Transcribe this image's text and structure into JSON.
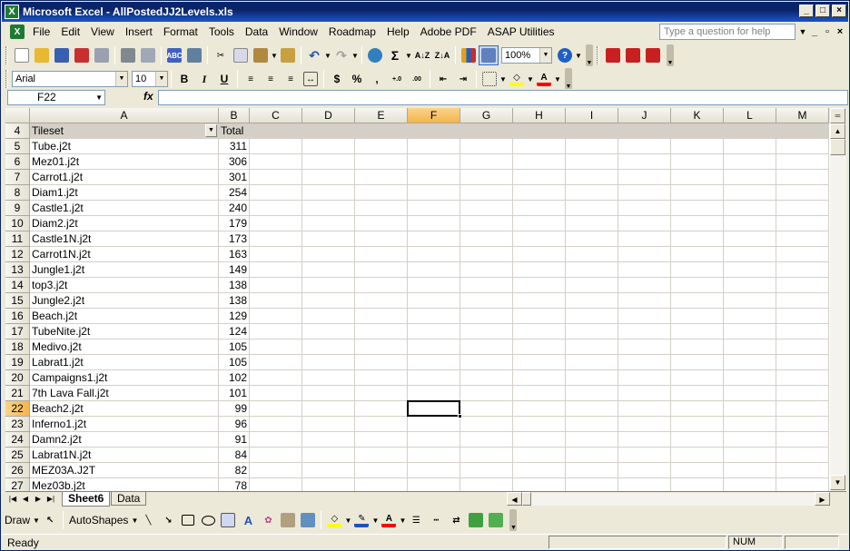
{
  "window": {
    "title": "Microsoft Excel - AllPostedJJ2Levels.xls"
  },
  "menu": {
    "items": [
      "File",
      "Edit",
      "View",
      "Insert",
      "Format",
      "Tools",
      "Data",
      "Window",
      "Roadmap",
      "Help",
      "Adobe PDF",
      "ASAP Utilities"
    ],
    "question_placeholder": "Type a question for help"
  },
  "toolbar": {
    "zoom": "100%"
  },
  "format_toolbar": {
    "font": "Arial",
    "size": "10",
    "bold": "B",
    "italic": "I",
    "underline": "U",
    "currency": "$",
    "percent": "%",
    "comma": ","
  },
  "formula_bar": {
    "name_box": "F22",
    "fx": "fx",
    "value": ""
  },
  "grid": {
    "columns": [
      "A",
      "B",
      "C",
      "D",
      "E",
      "F",
      "G",
      "H",
      "I",
      "J",
      "K",
      "L",
      "M"
    ],
    "selected_column": "F",
    "selected_row": "22",
    "header_row": {
      "row": "4",
      "a": "Tileset",
      "b": "Total"
    },
    "rows": [
      {
        "row": "5",
        "a": "Tube.j2t",
        "b": "311"
      },
      {
        "row": "6",
        "a": "Mez01.j2t",
        "b": "306"
      },
      {
        "row": "7",
        "a": "Carrot1.j2t",
        "b": "301"
      },
      {
        "row": "8",
        "a": "Diam1.j2t",
        "b": "254"
      },
      {
        "row": "9",
        "a": "Castle1.j2t",
        "b": "240"
      },
      {
        "row": "10",
        "a": "Diam2.j2t",
        "b": "179"
      },
      {
        "row": "11",
        "a": "Castle1N.j2t",
        "b": "173"
      },
      {
        "row": "12",
        "a": "Carrot1N.j2t",
        "b": "163"
      },
      {
        "row": "13",
        "a": "Jungle1.j2t",
        "b": "149"
      },
      {
        "row": "14",
        "a": "top3.j2t",
        "b": "138"
      },
      {
        "row": "15",
        "a": "Jungle2.j2t",
        "b": "138"
      },
      {
        "row": "16",
        "a": "Beach.j2t",
        "b": "129"
      },
      {
        "row": "17",
        "a": "TubeNite.j2t",
        "b": "124"
      },
      {
        "row": "18",
        "a": "Medivo.j2t",
        "b": "105"
      },
      {
        "row": "19",
        "a": "Labrat1.j2t",
        "b": "105"
      },
      {
        "row": "20",
        "a": "Campaigns1.j2t",
        "b": "102"
      },
      {
        "row": "21",
        "a": "7th Lava Fall.j2t",
        "b": "101"
      },
      {
        "row": "22",
        "a": "Beach2.j2t",
        "b": "99"
      },
      {
        "row": "23",
        "a": "Inferno1.j2t",
        "b": "96"
      },
      {
        "row": "24",
        "a": "Damn2.j2t",
        "b": "91"
      },
      {
        "row": "25",
        "a": "Labrat1N.j2t",
        "b": "84"
      },
      {
        "row": "26",
        "a": "MEZ03A.J2T",
        "b": "82"
      },
      {
        "row": "27",
        "a": "Mez03b.j2t",
        "b": "78"
      }
    ]
  },
  "sheets": {
    "tabs": [
      "Sheet6",
      "Data"
    ],
    "active": "Sheet6"
  },
  "drawing_toolbar": {
    "draw": "Draw",
    "autoshapes": "AutoShapes"
  },
  "status": {
    "text": "Ready",
    "num": "NUM"
  }
}
